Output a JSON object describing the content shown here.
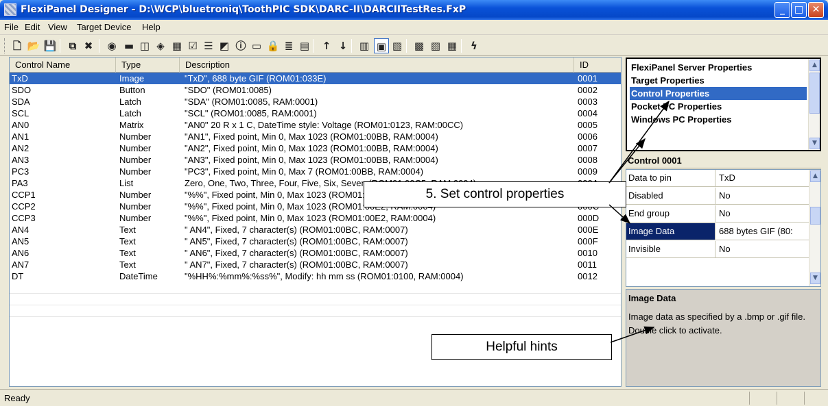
{
  "window": {
    "title": "FlexiPanel Designer - D:\\WCP\\bluetroniq\\ToothPIC SDK\\DARC-II\\DARCIITestRes.FxP"
  },
  "menu": [
    "File",
    "Edit",
    "View",
    "Target Device",
    "Help"
  ],
  "toolbar": [
    {
      "icon": "new-document-icon",
      "glyph": "🗋"
    },
    {
      "icon": "open-folder-icon",
      "glyph": "📂"
    },
    {
      "icon": "save-disk-icon",
      "glyph": "💾"
    },
    {
      "icon": "copy-icon",
      "glyph": "⧉"
    },
    {
      "icon": "delete-x-icon",
      "glyph": "✖"
    },
    {
      "icon": "browser-icon",
      "glyph": "◉"
    },
    {
      "icon": "button-control-icon",
      "glyph": "▬"
    },
    {
      "icon": "latch-control-icon",
      "glyph": "◫"
    },
    {
      "icon": "image-control-icon",
      "glyph": "◈"
    },
    {
      "icon": "matrix-control-icon",
      "glyph": "▦"
    },
    {
      "icon": "checkbox-control-icon",
      "glyph": "☑"
    },
    {
      "icon": "list-control-icon",
      "glyph": "☰"
    },
    {
      "icon": "chart-control-icon",
      "glyph": "◩"
    },
    {
      "icon": "alert-control-icon",
      "glyph": "ⓘ"
    },
    {
      "icon": "field-control-icon",
      "glyph": "▭"
    },
    {
      "icon": "password-control-icon",
      "glyph": "🔒"
    },
    {
      "icon": "text-control-icon",
      "glyph": "≣"
    },
    {
      "icon": "label-control-icon",
      "glyph": "▤"
    },
    {
      "icon": "move-up-arrow-icon",
      "glyph": "↑"
    },
    {
      "icon": "move-down-arrow-icon",
      "glyph": "↓"
    },
    {
      "icon": "layout-1-icon",
      "glyph": "▥"
    },
    {
      "icon": "layout-2-icon",
      "glyph": "▣"
    },
    {
      "icon": "layout-3-icon",
      "glyph": "▧"
    },
    {
      "icon": "build-1-icon",
      "glyph": "▩"
    },
    {
      "icon": "build-2-icon",
      "glyph": "▨"
    },
    {
      "icon": "build-3-icon",
      "glyph": "▦"
    },
    {
      "icon": "lightning-icon",
      "glyph": "ϟ"
    }
  ],
  "grid": {
    "columns": [
      "Control Name",
      "Type",
      "Description",
      "ID"
    ],
    "rows": [
      {
        "name": "TxD",
        "type": "Image",
        "desc": "\"TxD\",  688 byte GIF (ROM01:033E)",
        "id": "0001",
        "selected": true
      },
      {
        "name": "SDO",
        "type": "Button",
        "desc": "\"SDO\" (ROM01:0085)",
        "id": "0002"
      },
      {
        "name": "SDA",
        "type": "Latch",
        "desc": "\"SDA\" (ROM01:0085, RAM:0001)",
        "id": "0003"
      },
      {
        "name": "SCL",
        "type": "Latch",
        "desc": "\"SCL\" (ROM01:0085, RAM:0001)",
        "id": "0004"
      },
      {
        "name": "AN0",
        "type": "Matrix",
        "desc": "\"AN0\" 20 R x 1 C,  DateTime style: Voltage (ROM01:0123, RAM:00CC)",
        "id": "0005"
      },
      {
        "name": "AN1",
        "type": "Number",
        "desc": "\"AN1\",  Fixed point,  Min 0,  Max 1023 (ROM01:00BB, RAM:0004)",
        "id": "0006"
      },
      {
        "name": "AN2",
        "type": "Number",
        "desc": "\"AN2\",  Fixed point,  Min 0,  Max 1023 (ROM01:00BB, RAM:0004)",
        "id": "0007"
      },
      {
        "name": "AN3",
        "type": "Number",
        "desc": "\"AN3\",  Fixed point,  Min 0,  Max 1023 (ROM01:00BB, RAM:0004)",
        "id": "0008"
      },
      {
        "name": "PC3",
        "type": "Number",
        "desc": "\"PC3\",  Fixed point,  Min 0,  Max 7 (ROM01:00BB, RAM:0004)",
        "id": "0009"
      },
      {
        "name": "PA3",
        "type": "List",
        "desc": "Zero, One, Two, Three, Four, Five, Six, Seven (ROM01:00C5, RAM:0004)",
        "id": "000A"
      },
      {
        "name": "CCP1",
        "type": "Number",
        "desc": "\"%%\",  Fixed point,  Min 0,  Max 1023 (ROM01:00E2, RAM:0004)",
        "id": "000B"
      },
      {
        "name": "CCP2",
        "type": "Number",
        "desc": "\"%%\",  Fixed point,  Min 0,  Max 1023 (ROM01:00E2, RAM:0004)",
        "id": "000C"
      },
      {
        "name": "CCP3",
        "type": "Number",
        "desc": "\"%%\",  Fixed point,  Min 0,  Max 1023 (ROM01:00E2, RAM:0004)",
        "id": "000D"
      },
      {
        "name": "AN4",
        "type": "Text",
        "desc": "\"   AN4\",  Fixed,  7 character(s) (ROM01:00BC, RAM:0007)",
        "id": "000E"
      },
      {
        "name": "AN5",
        "type": "Text",
        "desc": "\"   AN5\",  Fixed,  7 character(s) (ROM01:00BC, RAM:0007)",
        "id": "000F"
      },
      {
        "name": "AN6",
        "type": "Text",
        "desc": "\"   AN6\",  Fixed,  7 character(s) (ROM01:00BC, RAM:0007)",
        "id": "0010"
      },
      {
        "name": "AN7",
        "type": "Text",
        "desc": "\"   AN7\",  Fixed,  7 character(s) (ROM01:00BC, RAM:0007)",
        "id": "0011"
      },
      {
        "name": "DT",
        "type": "DateTime",
        "desc": "\"%HH%:%mm%:%ss%\",  Modify:  hh mm ss (ROM01:0100, RAM:0004)",
        "id": "0012"
      }
    ]
  },
  "properties_list": {
    "items": [
      "FlexiPanel Server Properties",
      "Target Properties",
      "Control Properties",
      "Pocket PC Properties",
      "Windows PC Properties"
    ],
    "selected_index": 2
  },
  "control_panel": {
    "title": "Control 0001",
    "properties": [
      {
        "key": "Data to pin",
        "value": "TxD"
      },
      {
        "key": "Disabled",
        "value": "No"
      },
      {
        "key": "End group",
        "value": "No"
      },
      {
        "key": "Image Data",
        "value": "688 bytes GIF (80:",
        "selected": true
      },
      {
        "key": "Invisible",
        "value": "No"
      }
    ]
  },
  "hint": {
    "title": "Image Data",
    "text": "Image data as specified by a .bmp or .gif file.  Double click to activate."
  },
  "callouts": {
    "set_props": "5. Set control properties",
    "hints": "Helpful hints"
  },
  "status": {
    "text": "Ready"
  },
  "colors": {
    "title_blue": "#0a52d8",
    "selection": "#316ac5"
  }
}
